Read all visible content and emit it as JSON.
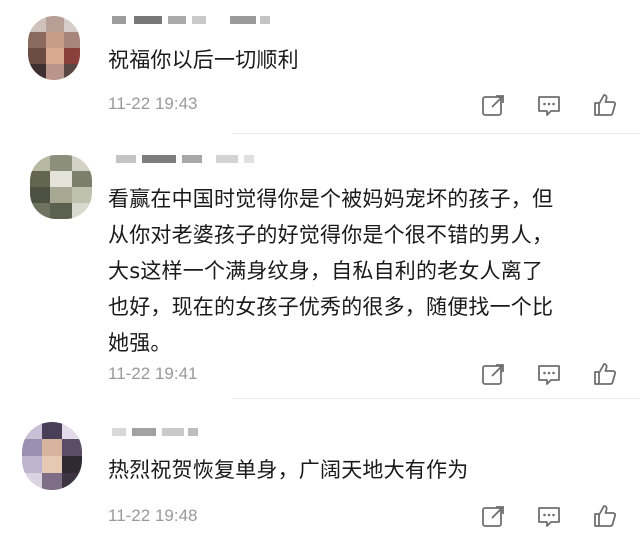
{
  "comments": [
    {
      "text": "祝福你以后一切顺利",
      "time": "11-22 19:43"
    },
    {
      "text": "看赢在中国时觉得你是个被妈妈宠坏的孩子，但\n从你对老婆孩子的好觉得你是个很不错的男人，\n大s这样一个满身纹身，自私自利的老女人离了\n也好，现在的女孩子优秀的很多，随便找一个比\n她强。",
      "time": "11-22 19:41"
    },
    {
      "text": "热烈祝贺恢复单身，广阔天地大有作为",
      "time": "11-22 19:48"
    }
  ],
  "icons": {
    "share": "share-icon",
    "reply": "comment-icon",
    "like": "thumbs-up-icon"
  },
  "colors": {
    "text": "#1a1a1a",
    "meta": "#9a9a9a",
    "icon": "#6f6f6f",
    "divider": "#ececec"
  }
}
